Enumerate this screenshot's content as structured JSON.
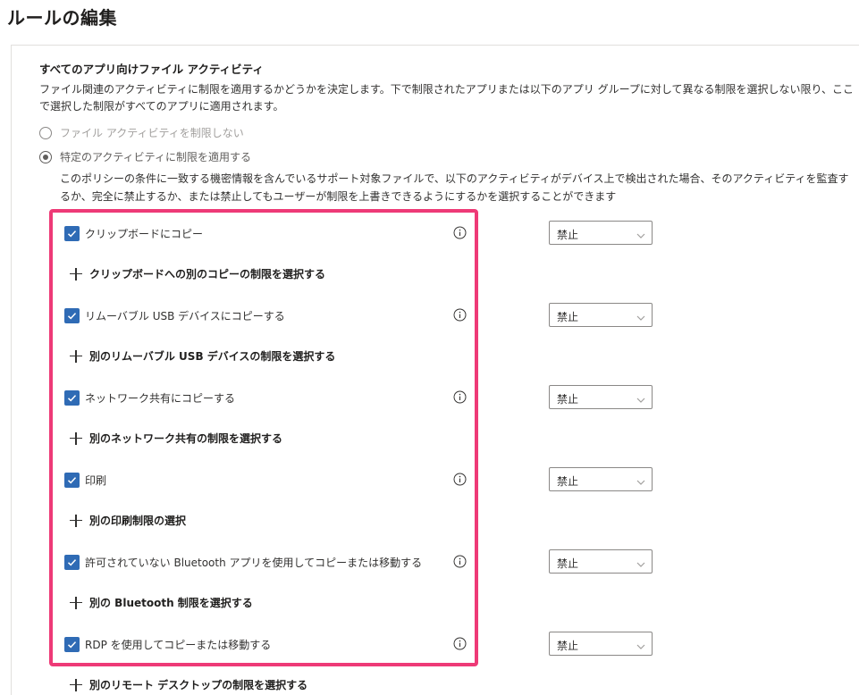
{
  "page": {
    "title": "ルールの編集"
  },
  "section": {
    "heading": "すべてのアプリ向けファイル アクティビティ",
    "description": "ファイル関連のアクティビティに制限を適用するかどうかを決定します。下で制限されたアプリまたは以下のアプリ グループに対して異なる制限を選択しない限り、ここで選択した制限がすべてのアプリに適用されます。"
  },
  "radios": [
    {
      "label": "ファイル アクティビティを制限しない",
      "checked": false
    },
    {
      "label": "特定のアクティビティに制限を適用する",
      "checked": true
    }
  ],
  "restrict_description": "このポリシーの条件に一致する機密情報を含んでいるサポート対象ファイルで、以下のアクティビティがデバイス上で検出された場合、そのアクティビティを監査するか、完全に禁止するか、または禁止してもユーザーが制限を上書きできるようにするかを選択することができます",
  "activities": [
    {
      "label": "クリップボードにコピー",
      "checked": true,
      "action": "禁止",
      "add_label": "クリップボードへの別のコピーの制限を選択する"
    },
    {
      "label": "リムーバブル USB デバイスにコピーする",
      "checked": true,
      "action": "禁止",
      "add_label": "別のリムーバブル USB デバイスの制限を選択する"
    },
    {
      "label": "ネットワーク共有にコピーする",
      "checked": true,
      "action": "禁止",
      "add_label": "別のネットワーク共有の制限を選択する"
    },
    {
      "label": "印刷",
      "checked": true,
      "action": "禁止",
      "add_label": "別の印刷制限の選択"
    },
    {
      "label": "許可されていない Bluetooth アプリを使用してコピーまたは移動する",
      "checked": true,
      "action": "禁止",
      "add_label": "別の Bluetooth 制限を選択する"
    },
    {
      "label": "RDP を使用してコピーまたは移動する",
      "checked": true,
      "action": "禁止",
      "add_label": "別のリモート デスクトップの制限を選択する"
    }
  ],
  "icons": {
    "checkbox": "checkmark-icon",
    "info": "info-icon",
    "add": "plus-icon",
    "dropdown": "chevron-down-icon"
  },
  "colors": {
    "checkbox_fill": "#2f6bb5",
    "highlight_border": "#ee3a77"
  }
}
